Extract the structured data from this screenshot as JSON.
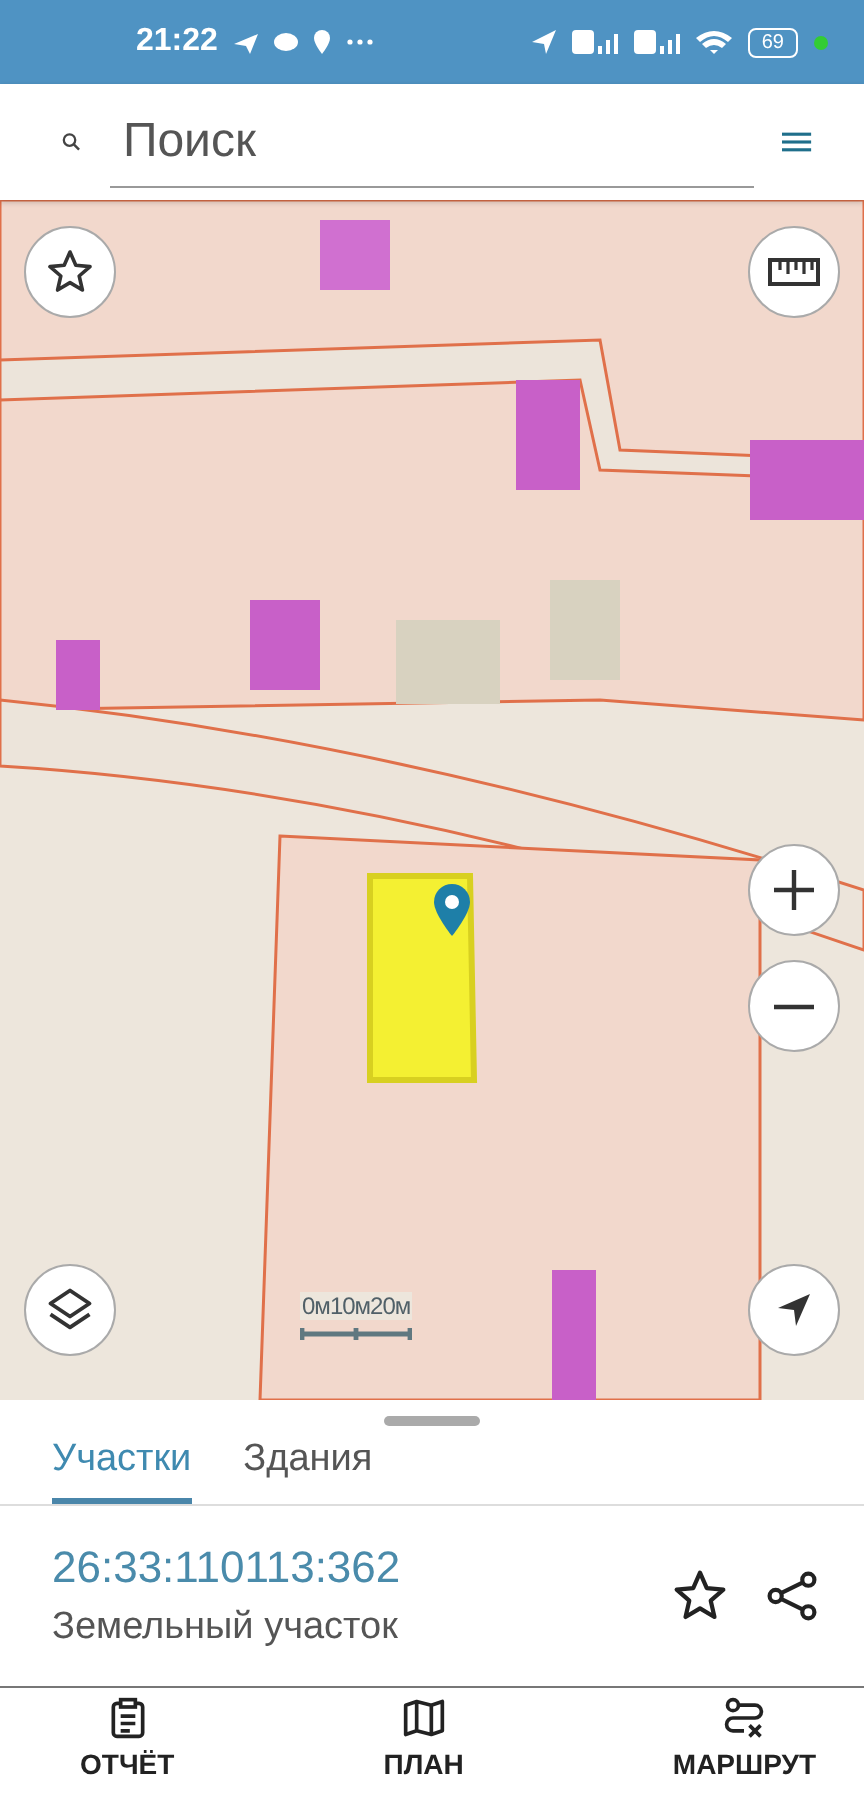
{
  "status_bar": {
    "time": "21:22",
    "battery": "69"
  },
  "search": {
    "placeholder": "Поиск"
  },
  "map": {
    "scale_labels": [
      "0м",
      "10м",
      "20м"
    ]
  },
  "tabs": [
    {
      "label": "Участки",
      "selected": true
    },
    {
      "label": "Здания",
      "selected": false
    }
  ],
  "parcel": {
    "number": "26:33:110113:362",
    "type": "Земельный участок"
  },
  "bottom_nav": [
    {
      "label": "ОТЧЁТ",
      "kind": "report"
    },
    {
      "label": "ПЛАН",
      "kind": "plan"
    },
    {
      "label": "МАРШРУТ",
      "kind": "route"
    }
  ]
}
